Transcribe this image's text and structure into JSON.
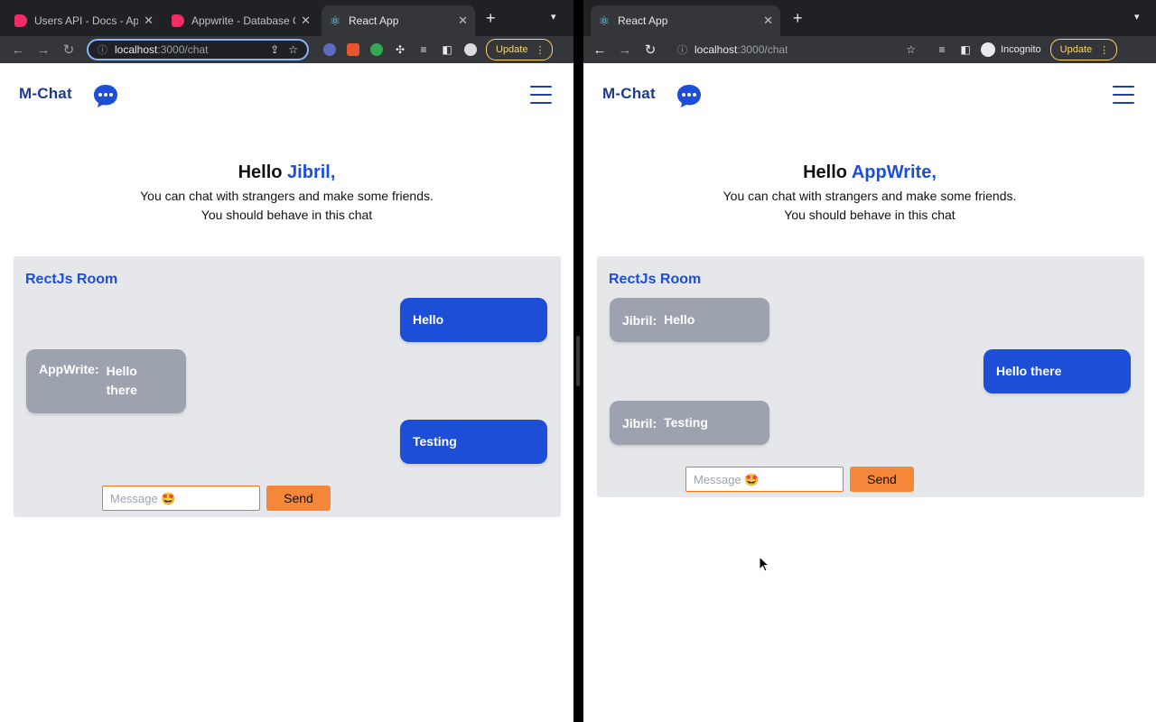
{
  "left_window": {
    "tabs": [
      {
        "title": "Users API - Docs - Ap",
        "favicon": "appwrite-icon"
      },
      {
        "title": "Appwrite - Database C",
        "favicon": "appwrite-icon"
      },
      {
        "title": "React App",
        "favicon": "react-icon"
      }
    ],
    "url_host": "localhost",
    "url_path": ":3000/chat",
    "update_label": "Update",
    "app": {
      "brand": "M-Chat",
      "hello_prefix": "Hello ",
      "username": "Jibril,",
      "line1": "You can chat with strangers and make some friends.",
      "line2": "You should behave in this chat",
      "room_title": "RectJs Room",
      "messages": [
        {
          "sender": "",
          "text": "Hello",
          "mine": true
        },
        {
          "sender": "AppWrite:",
          "text": "Hello there",
          "mine": false
        },
        {
          "sender": "",
          "text": "Testing",
          "mine": true
        }
      ],
      "input_placeholder": "Message 🤩",
      "send_label": "Send"
    }
  },
  "right_window": {
    "tabs": [
      {
        "title": "React App",
        "favicon": "react-icon"
      }
    ],
    "url_host": "localhost",
    "url_path": ":3000/chat",
    "incognito_label": "Incognito",
    "update_label": "Update",
    "app": {
      "brand": "M-Chat",
      "hello_prefix": "Hello ",
      "username": "AppWrite,",
      "line1": "You can chat with strangers and make some friends.",
      "line2": "You should behave in this chat",
      "room_title": "RectJs Room",
      "messages": [
        {
          "sender": "Jibril:",
          "text": "Hello",
          "mine": false
        },
        {
          "sender": "",
          "text": "Hello there",
          "mine": true
        },
        {
          "sender": "Jibril:",
          "text": "Testing",
          "mine": false
        }
      ],
      "input_placeholder": "Message 🤩",
      "send_label": "Send"
    }
  },
  "colors": {
    "brand": "#1e3a8a",
    "accent_blue": "#1d4ed8",
    "other_bubble": "#9ca3af",
    "room_bg": "#e5e7eb",
    "send_orange": "#f5873b"
  }
}
